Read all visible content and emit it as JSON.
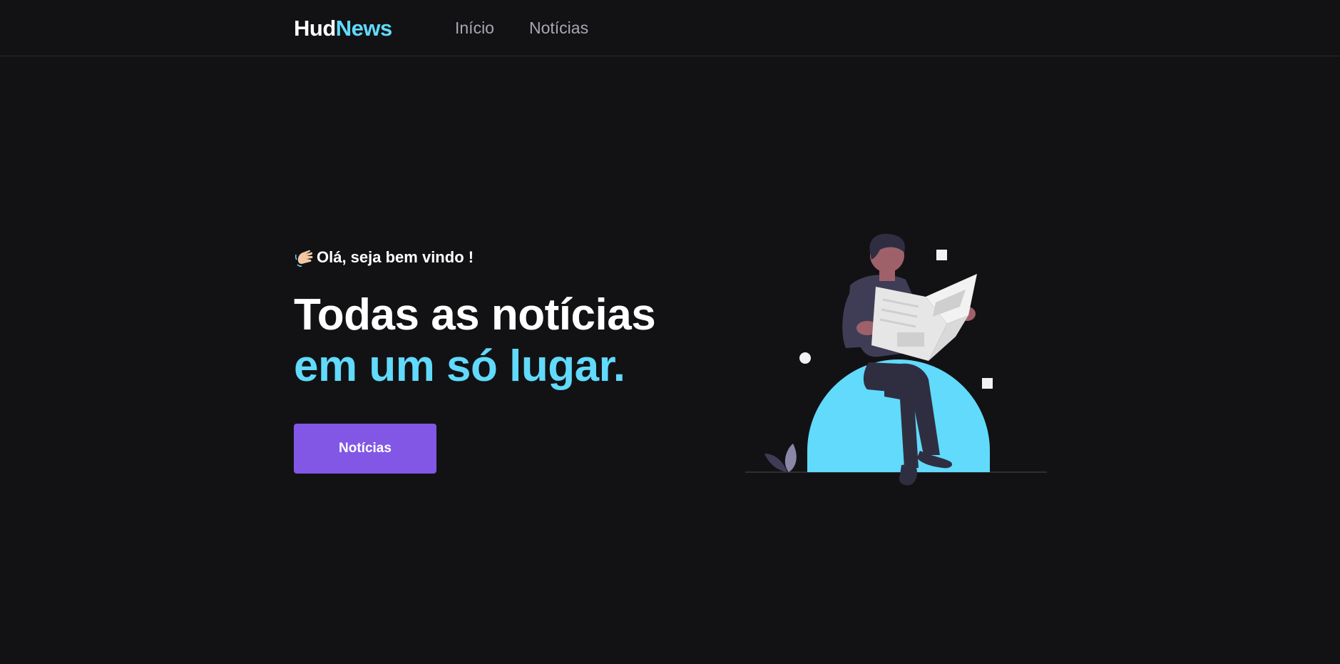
{
  "header": {
    "logo": {
      "part1": "Hud",
      "part2": "News"
    },
    "nav": [
      {
        "label": "Início"
      },
      {
        "label": "Notícias"
      }
    ]
  },
  "hero": {
    "greeting_icon": "waving-hand-icon",
    "greeting": "Olá, seja bem vindo !",
    "headline_line1": "Todas as notícias",
    "headline_line2": "em um só lugar.",
    "cta_label": "Notícias"
  },
  "colors": {
    "background": "#121214",
    "accent": "#61dafb",
    "button": "#8257e5",
    "nav_text": "#a8a8b3"
  }
}
